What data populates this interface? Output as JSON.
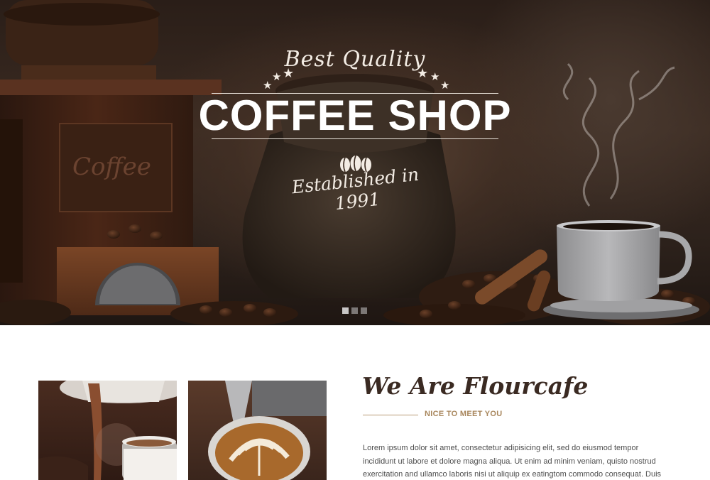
{
  "hero": {
    "script_top": "Best Quality",
    "title": "COFFEE SHOP",
    "script_bottom": "Established in 1991",
    "grinder_label": "Coffee",
    "beans_icon": "coffee-beans-icon",
    "star_icon": "star-icon",
    "slider": {
      "count": 3,
      "active": 1
    }
  },
  "about": {
    "heading": "We Are Flourcafe",
    "subheading": "NICE TO MEET YOU",
    "body": "Lorem ipsum dolor sit amet, consectetur adipisicing elit, sed do eiusmod tempor incididunt ut labore et dolore magna aliqua. Ut enim ad minim veniam, quisto nostrud exercitation and ullamco laboris nisi ut aliquip ex eatingtom commodo consequat. Duis"
  },
  "colors": {
    "accent": "#a8865c",
    "heading": "#3a2a22",
    "body_text": "#4d4d4d"
  }
}
